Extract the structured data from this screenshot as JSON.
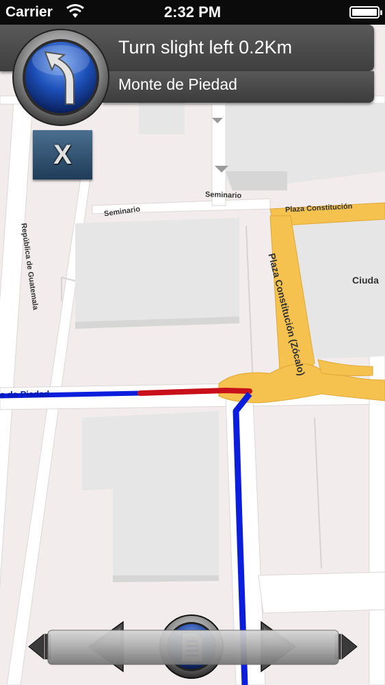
{
  "status_bar": {
    "carrier": "Carrier",
    "time": "2:32 PM",
    "battery_level": 1.0
  },
  "navigation": {
    "instruction": "Turn slight left 0.2Km",
    "street": "Monte de Piedad",
    "turn_icon": "slight-left-arrow-icon",
    "close_label": "X"
  },
  "map": {
    "labels": {
      "seminario_1": "Seminario",
      "seminario_2": "Seminario",
      "republica": "República de Guatemala",
      "plaza_top": "Plaza Constitución",
      "plaza_diag": "Plaza Constitución (Zócalo)",
      "ciudad": "Ciuda",
      "monte_route": "e de Piedad"
    },
    "colors": {
      "route_blue": "#0a1edc",
      "route_red": "#c8101a",
      "highlight_road": "#f6c24f",
      "building": "#e2e2e2",
      "background": "#f2ecec"
    }
  },
  "bottom_nav": {
    "first": "skip-back-icon",
    "prev": "previous-arrow-icon",
    "list": "directions-list-icon",
    "next": "next-arrow-icon",
    "last": "skip-forward-icon"
  }
}
